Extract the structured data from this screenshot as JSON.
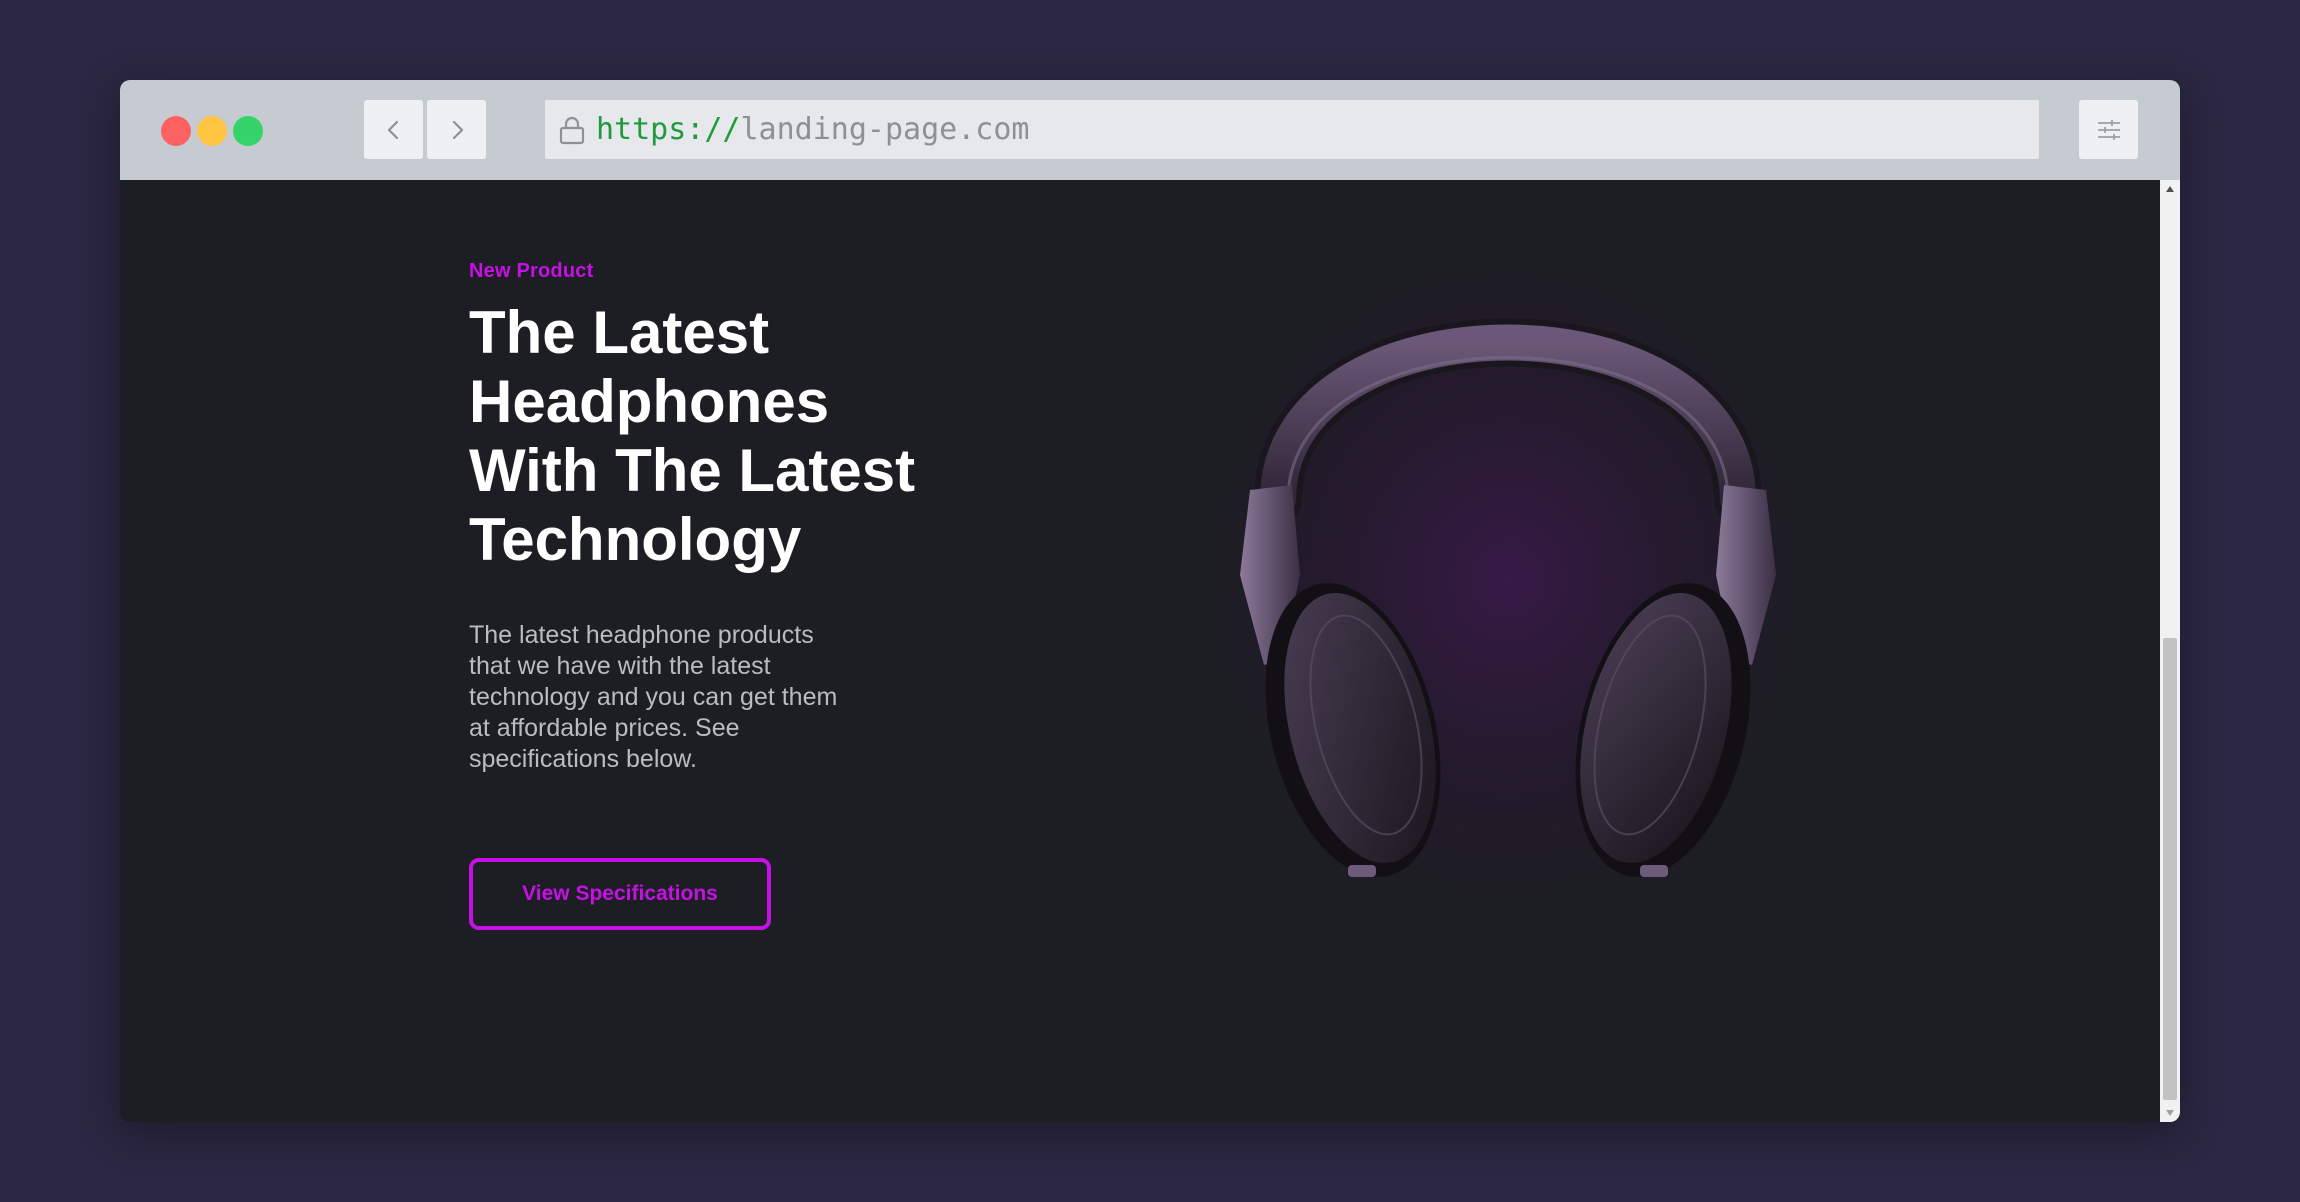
{
  "browser": {
    "url_protocol": "https://",
    "url_host": "landing-page.com",
    "colors": {
      "background": "#2c2742",
      "toolbar": "#c6cbd2",
      "close_dot": "#ff6361",
      "minimize_dot": "#ffc442",
      "maximize_dot": "#35d46b",
      "url_protocol": "#1f9a3c"
    }
  },
  "hero": {
    "eyebrow": "New Product",
    "headline_line1": "The Latest",
    "headline_line2": "Headphones",
    "headline_line3": "With The Latest",
    "headline_line4": "Technology",
    "description": "The latest headphone products that we have with the latest technology and you can get them at affordable prices. See specifications below.",
    "cta_label": "View Specifications",
    "colors": {
      "page_background": "#1c1e23",
      "accent": "#c610e6",
      "headline": "#ffffff",
      "body_text": "#b9bcc2"
    }
  },
  "scrollbar": {
    "position_fraction": 0.55
  }
}
